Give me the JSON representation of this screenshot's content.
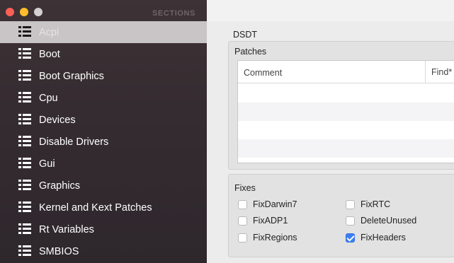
{
  "sidebar": {
    "header": "SECTIONS",
    "items": [
      {
        "label": "Acpi",
        "selected": true
      },
      {
        "label": "Boot"
      },
      {
        "label": "Boot Graphics"
      },
      {
        "label": "Cpu"
      },
      {
        "label": "Devices"
      },
      {
        "label": "Disable Drivers"
      },
      {
        "label": "Gui"
      },
      {
        "label": "Graphics"
      },
      {
        "label": "Kernel and Kext Patches"
      },
      {
        "label": "Rt Variables"
      },
      {
        "label": "SMBIOS"
      }
    ]
  },
  "main": {
    "section_title": "DSDT",
    "patches": {
      "title": "Patches",
      "columns": [
        "Comment",
        "Find*"
      ]
    },
    "fixes": {
      "title": "Fixes",
      "items": [
        {
          "label": "FixDarwin7",
          "checked": false
        },
        {
          "label": "FixRTC",
          "checked": false
        },
        {
          "label": "FixADP1",
          "checked": false
        },
        {
          "label": "DeleteUnused",
          "checked": false
        },
        {
          "label": "FixRegions",
          "checked": false
        },
        {
          "label": "FixHeaders",
          "checked": true
        }
      ]
    }
  },
  "colors": {
    "sidebar_bg": "#352c31",
    "selected_row": "#c9c5c7",
    "checkbox_accent": "#3b7ff5",
    "close": "#fc5f57",
    "minimize": "#fdbc2e"
  }
}
